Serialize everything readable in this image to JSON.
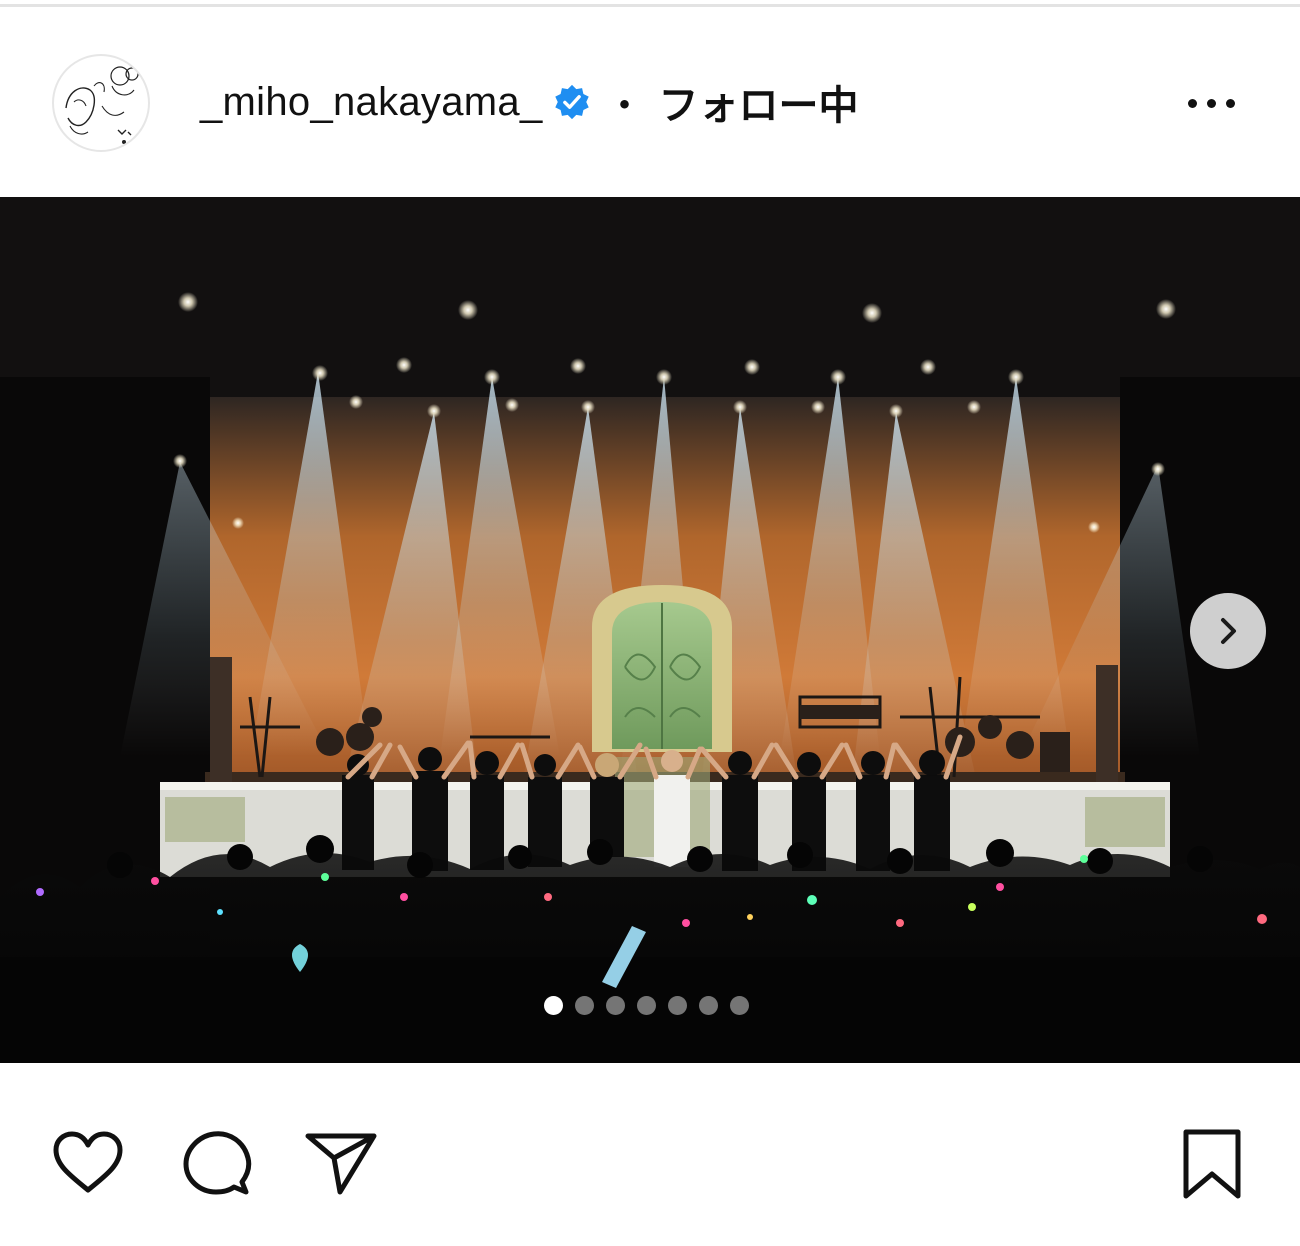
{
  "post": {
    "username": "_miho_nakayama_",
    "verified": true,
    "separator": "・",
    "follow_status": "フォロー中",
    "more_icon": "more-horizontal-icon"
  },
  "carousel": {
    "total_slides": 7,
    "active_index": 0,
    "next_icon": "chevron-right-icon"
  },
  "actions": {
    "like_icon": "heart-icon",
    "comment_icon": "comment-icon",
    "share_icon": "send-icon",
    "save_icon": "bookmark-icon"
  },
  "colors": {
    "verified_blue": "#1f8ef1",
    "stage_orange": "#c8702f",
    "door_green": "#7da86a"
  }
}
